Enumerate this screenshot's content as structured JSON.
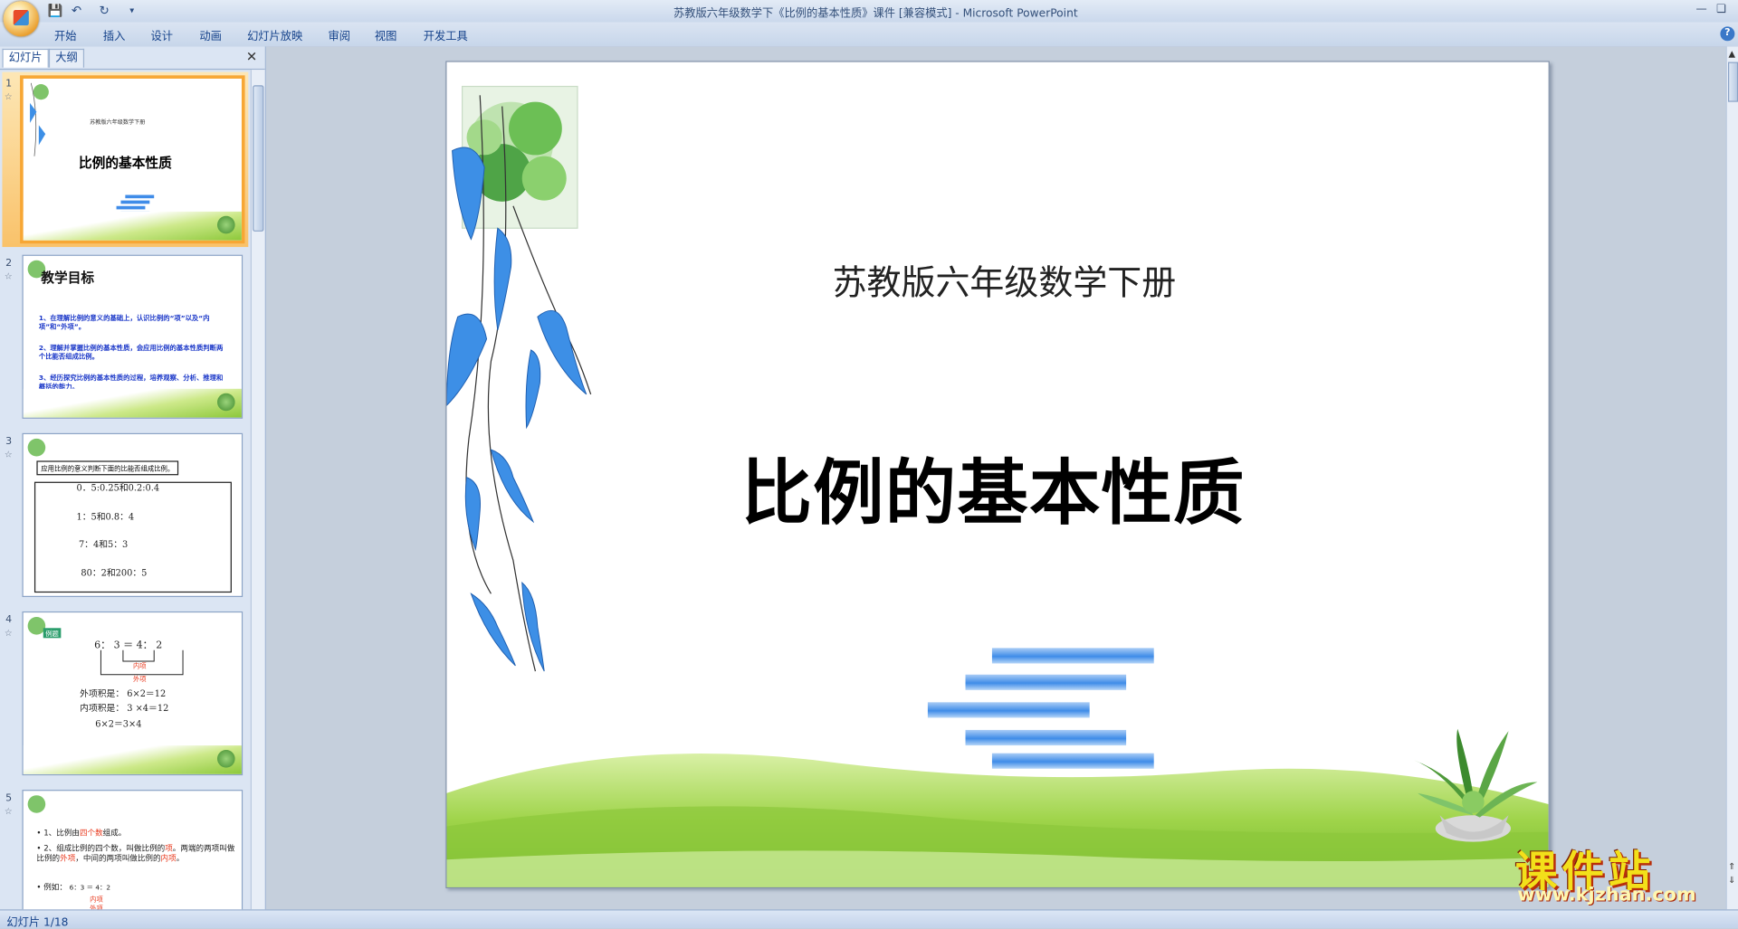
{
  "window": {
    "title": "苏教版六年级数学下《比例的基本性质》课件 [兼容模式] - Microsoft PowerPoint"
  },
  "ribbon": {
    "tabs": [
      "开始",
      "插入",
      "设计",
      "动画",
      "幻灯片放映",
      "审阅",
      "视图",
      "开发工具"
    ]
  },
  "panel": {
    "tabs": [
      "幻灯片",
      "大纲"
    ]
  },
  "thumbnails": {
    "numbers": [
      "1",
      "2",
      "3",
      "4",
      "5"
    ],
    "s1": {
      "subtitle": "苏教版六年级数学下册",
      "title": "比例的基本性质"
    },
    "s2": {
      "heading": "教学目标",
      "p1": "1、在理解比例的意义的基础上，认识比例的“项”以及“内项”和“外项”。",
      "p2": "2、理解并掌握比例的基本性质，会应用比例的基本性质判断两个比能否组成比例。",
      "p3": "3、经历探究比例的基本性质的过程，培养观察、分析、推理和概括的能力。"
    },
    "s3": {
      "label": "应用比例的意义判断下面的比能否组成比例。",
      "l1": "0．5:0.25和0.2:0.4",
      "l2": "1：5和0.8：4",
      "l3": "7：4和5：3",
      "l4": "80：2和200：5"
    },
    "s4": {
      "badge": "例题",
      "eq": "6： 3 ＝  4： 2",
      "inner": "内项",
      "outer": "外项",
      "l1": "外项积是： 6×2＝12",
      "l2": "内项积是： 3 ×4＝12",
      "l3": "6×2＝3×4"
    },
    "s5": {
      "b1a": "1、比例由",
      "b1red": "四个数",
      "b1b": "组成。",
      "b2a": "2、组成比例的四个数，叫做比例的",
      "b2red1": "项",
      "b2b": "。两端的两项叫做比例的",
      "b2red2": "外项",
      "b2c": "，中间的两项叫做比例的",
      "b2red3": "内项",
      "b2d": "。",
      "ex": "例如：",
      "exeq": "6：3 ＝ 4：2",
      "exinner": "内项",
      "exouter": "外项"
    }
  },
  "slide": {
    "subtitle": "苏教版六年级数学下册",
    "title": "比例的基本性质"
  },
  "status": {
    "text": "幻灯片 1/18"
  },
  "watermark": {
    "text": "课件站",
    "url": "www.kjzhan.com"
  },
  "colors": {
    "selection": "#f7a735",
    "bar_blue": "#3f8ce8",
    "grass_green": "#8cc83a",
    "leaf_blue": "#3d8fe6",
    "emphasis_red": "#e8381c"
  }
}
